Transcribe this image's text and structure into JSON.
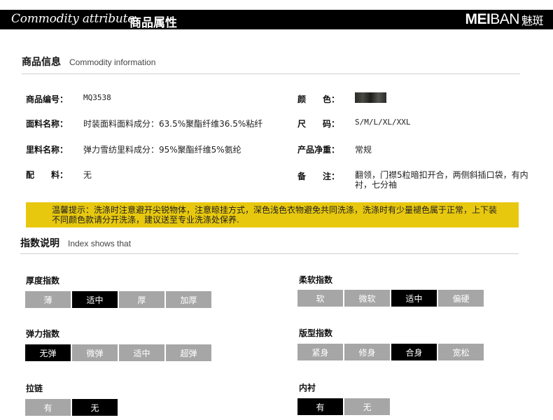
{
  "header": {
    "title_en": "Commodity attribute",
    "title_cn": "商品属性",
    "brand_a": "MEI",
    "brand_b": "BAN",
    "brand_c": "魅斑"
  },
  "info_section": {
    "title_cn": "商品信息",
    "title_en": "Commodity information",
    "left": [
      {
        "label": "商品编号：",
        "value": "MQ3538"
      },
      {
        "label": "面料名称：",
        "value": "时装面料面料成分：63.5%聚酯纤维36.5%粘纤"
      },
      {
        "label": "里料名称：",
        "value": "弹力雪纺里料成分：95%聚酯纤维5%氨纶"
      },
      {
        "label": "配　　料：",
        "value": "无"
      }
    ],
    "right": [
      {
        "label": "颜　　色：",
        "value": ""
      },
      {
        "label": "尺　　码：",
        "value": "S/M/L/XL/XXL"
      },
      {
        "label": "产品净重：",
        "value": "常规"
      },
      {
        "label": "备　　注：",
        "value": "翻领，门襟5粒暗扣开合，两侧斜插口袋，有内衬，七分袖"
      }
    ],
    "color_swatch": "#2e2e2a"
  },
  "notice": {
    "line1": "温馨提示：洗涤时注意避开尖锐物体，注意晾挂方式，深色浅色衣物避免共同洗涤，洗涤时有少量褪色属于正常，上下装",
    "line2": "不同颜色款请分开洗涤，建议送至专业洗涤处保养.",
    "bg_color": "#e8c80e"
  },
  "index_section": {
    "title_cn": "指数说明",
    "title_en": "Index shows that",
    "groups": [
      {
        "title": "厚度指数",
        "options": [
          "薄",
          "适中",
          "厚",
          "加厚"
        ],
        "selected": 1
      },
      {
        "title": "柔软指数",
        "options": [
          "软",
          "微软",
          "适中",
          "偏硬"
        ],
        "selected": 2
      },
      {
        "title": "弹力指数",
        "options": [
          "无弹",
          "微弹",
          "适中",
          "超弹"
        ],
        "selected": 0
      },
      {
        "title": "版型指数",
        "options": [
          "紧身",
          "修身",
          "合身",
          "宽松"
        ],
        "selected": 2
      },
      {
        "title": "拉链",
        "options": [
          "有",
          "无"
        ],
        "selected": 1
      },
      {
        "title": "内衬",
        "options": [
          "有",
          "无"
        ],
        "selected": 0
      }
    ]
  }
}
